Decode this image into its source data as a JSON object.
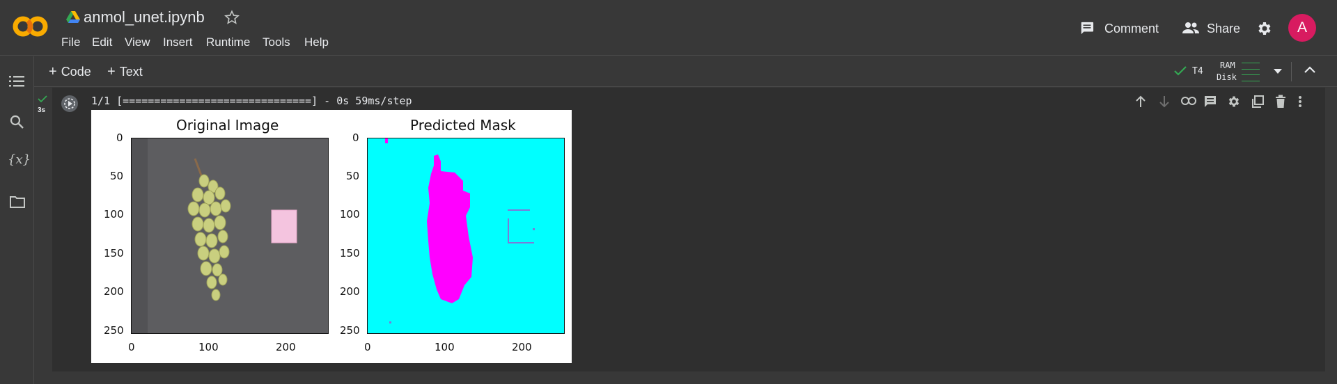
{
  "header": {
    "file_name": "anmol_unet.ipynb",
    "menu": [
      "File",
      "Edit",
      "View",
      "Insert",
      "Runtime",
      "Tools",
      "Help"
    ],
    "comment_label": "Comment",
    "share_label": "Share",
    "avatar_letter": "A",
    "logo_text": "CO"
  },
  "toolbar": {
    "add_code_label": "Code",
    "add_text_label": "Text",
    "runtime_label": "T4",
    "ram_label": "RAM",
    "disk_label": "Disk"
  },
  "cell": {
    "exec_time": "3s",
    "output_text": "1/1 [==============================] - 0s 59ms/step"
  },
  "colors": {
    "accent_orange": "#f9ab00",
    "avatar_bg": "#d81b60",
    "check_green": "#34a853",
    "mask_background": "#00ffff",
    "mask_foreground": "#ff00ff"
  },
  "figures": [
    {
      "title": "Original Image",
      "x_ticks": [
        "0",
        "100",
        "200"
      ],
      "y_ticks": [
        "0",
        "50",
        "100",
        "150",
        "200",
        "250"
      ]
    },
    {
      "title": "Predicted Mask",
      "x_ticks": [
        "0",
        "100",
        "200"
      ],
      "y_ticks": [
        "0",
        "50",
        "100",
        "150",
        "200",
        "250"
      ]
    }
  ]
}
